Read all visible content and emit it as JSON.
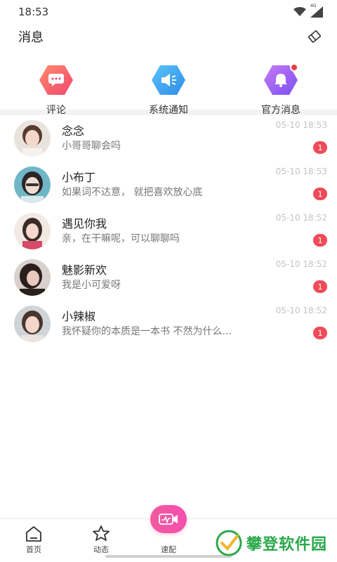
{
  "status_bar": {
    "time": "18:53",
    "network": "4G"
  },
  "header": {
    "title": "消息",
    "clear_icon": "clear-messages-icon"
  },
  "quick_entries": [
    {
      "label": "评论",
      "icon": "comment-icon",
      "color": "#f5566f"
    },
    {
      "label": "系统通知",
      "icon": "speaker-icon",
      "color": "#3aa6f2"
    },
    {
      "label": "官方消息",
      "icon": "bell-icon",
      "color": "#9a5af0",
      "has_dot": true
    }
  ],
  "conversations": [
    {
      "name": "念念",
      "message": "小哥哥聊会吗",
      "time": "05-10 18:53",
      "unread": "1"
    },
    {
      "name": "小布丁",
      "message": "如果词不达意， 就把喜欢放心底",
      "time": "05-10 18:53",
      "unread": "1"
    },
    {
      "name": "遇见你我",
      "message": "亲，在干嘛呢，可以聊聊吗",
      "time": "05-10 18:52",
      "unread": "1"
    },
    {
      "name": "魅影新欢",
      "message": "我是小可爱呀",
      "time": "05-10 18:52",
      "unread": "1"
    },
    {
      "name": "小辣椒",
      "message": "我怀疑你的本质是一本书 不然为什么...",
      "time": "05-10 18:52",
      "unread": "1"
    }
  ],
  "tabbar": {
    "home": "首页",
    "feed": "动态",
    "match": "速配"
  },
  "watermark": "攀登软件园"
}
